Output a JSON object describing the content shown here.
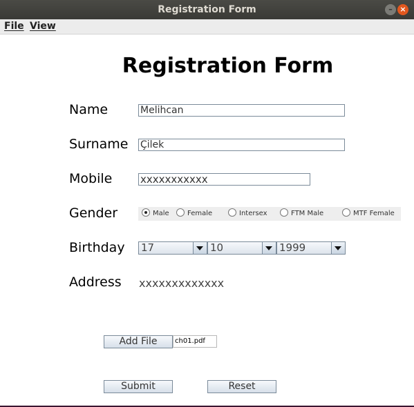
{
  "window": {
    "title": "Registration Form",
    "minimize_glyph": "–",
    "close_glyph": "×"
  },
  "menu": {
    "file": "File",
    "view": "View"
  },
  "form": {
    "title": "Registration Form",
    "name": {
      "label": "Name",
      "value": "Melihcan"
    },
    "surname": {
      "label": "Surname",
      "value": "Çilek"
    },
    "mobile": {
      "label": "Mobile",
      "value": "xxxxxxxxxxx"
    },
    "gender": {
      "label": "Gender",
      "options": [
        "Male",
        "Female",
        "Intersex",
        "FTM Male",
        "MTF Female"
      ],
      "selected": "Male"
    },
    "birthday": {
      "label": "Birthday",
      "day": "17",
      "month": "10",
      "year": "1999"
    },
    "address": {
      "label": "Address",
      "value": "xxxxxxxxxxxxx"
    },
    "add_file_label": "Add File",
    "file_name": "ch01.pdf",
    "submit_label": "Submit",
    "reset_label": "Reset"
  }
}
